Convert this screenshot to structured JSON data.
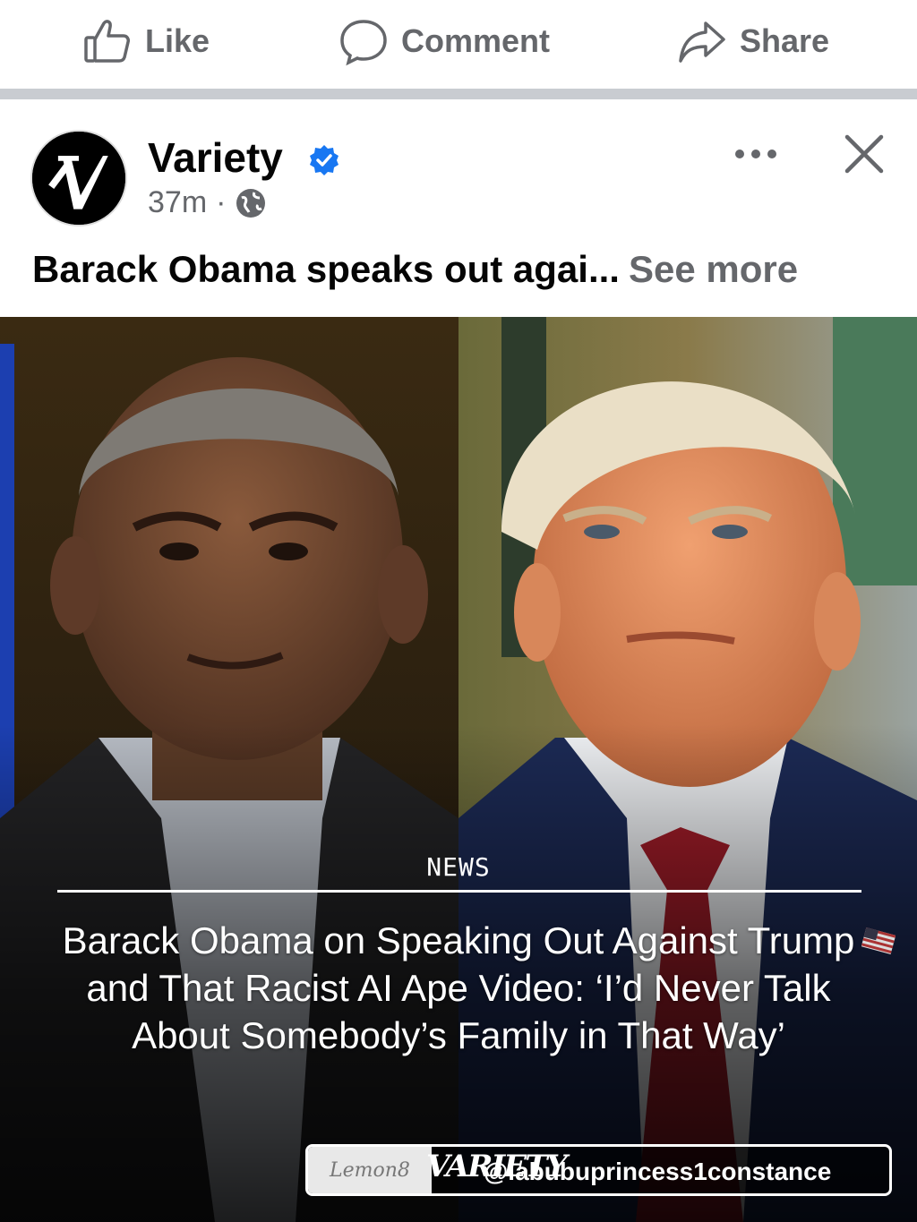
{
  "actions": {
    "like_label": "Like",
    "comment_label": "Comment",
    "share_label": "Share"
  },
  "post": {
    "page_name": "Variety",
    "verified": true,
    "time": "37m",
    "visibility_icon": "globe-icon",
    "caption": "Barack Obama speaks out agai...",
    "see_more": "See more"
  },
  "image": {
    "category": "NEWS",
    "headline": "Barack Obama on Speaking Out Against Trump and That Racist AI Ape Video: ‘I’d Never Talk About Somebody’s Family in That Way’",
    "watermark_brand": "Lemon8",
    "watermark_logo": "VARIETY",
    "watermark_handle": "@labubuprincess1constance"
  },
  "colors": {
    "text_secondary": "#65676b",
    "verified_blue": "#1877f2",
    "divider": "#c9ccd1"
  }
}
